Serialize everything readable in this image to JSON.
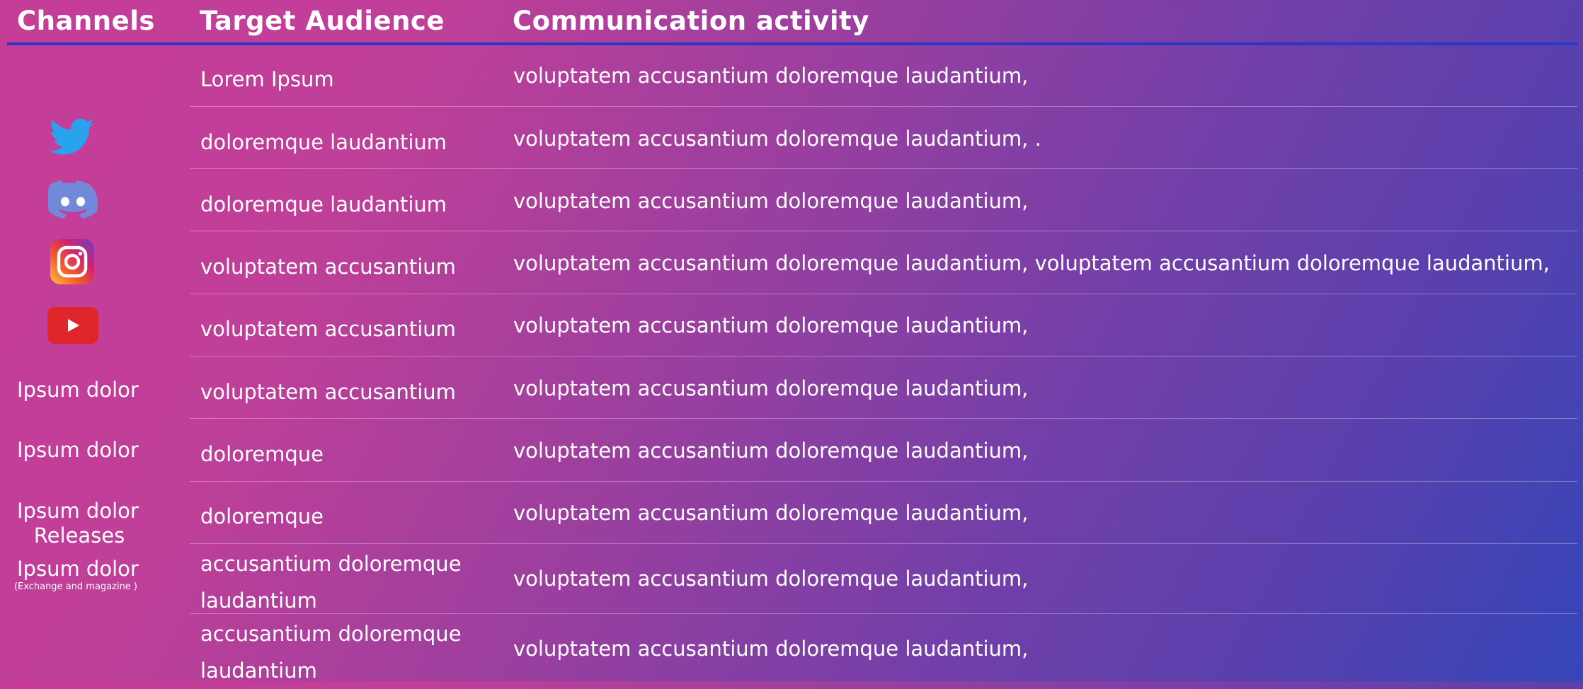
{
  "header": {
    "channels": "Channels",
    "audience": "Target Audience",
    "activity": "Communication activity"
  },
  "rows": [
    {
      "audience": "Lorem Ipsum",
      "activity": "voluptatem accusantium doloremque laudantium,"
    },
    {
      "audience": "doloremque laudantium",
      "activity": "voluptatem accusantium doloremque laudantium, ."
    },
    {
      "audience": "doloremque laudantium",
      "activity": "voluptatem accusantium doloremque laudantium,"
    },
    {
      "audience": "voluptatem accusantium",
      "activity": "voluptatem accusantium doloremque laudantium, voluptatem accusantium doloremque laudantium,"
    },
    {
      "audience": "voluptatem accusantium",
      "activity": "voluptatem accusantium doloremque laudantium,"
    },
    {
      "audience": "voluptatem accusantium",
      "activity": "voluptatem accusantium doloremque laudantium,"
    },
    {
      "audience": "doloremque",
      "activity": "voluptatem accusantium doloremque laudantium,"
    },
    {
      "audience": "doloremque",
      "activity": "voluptatem accusantium doloremque laudantium,"
    },
    {
      "audience": "accusantium doloremque laudantium",
      "activity": "voluptatem accusantium doloremque laudantium,"
    },
    {
      "audience": "accusantium doloremque laudantium",
      "activity": "voluptatem accusantium doloremque laudantium,"
    }
  ],
  "channels": {
    "icons": [
      "twitter-icon",
      "discord-icon",
      "instagram-icon",
      "youtube-icon"
    ],
    "label_1": "Ipsum dolor",
    "label_2": "Ipsum dolor",
    "label_3_line1": "Ipsum dolor",
    "label_3_line2": "Releases",
    "label_4": "Ipsum dolor",
    "label_4_sub": "(Exchange and magazine )"
  },
  "colors": {
    "header_rule": "#2a36c9",
    "twitter": "#2aa3ef",
    "discord": "#7289da",
    "youtube": "#e0262a"
  }
}
